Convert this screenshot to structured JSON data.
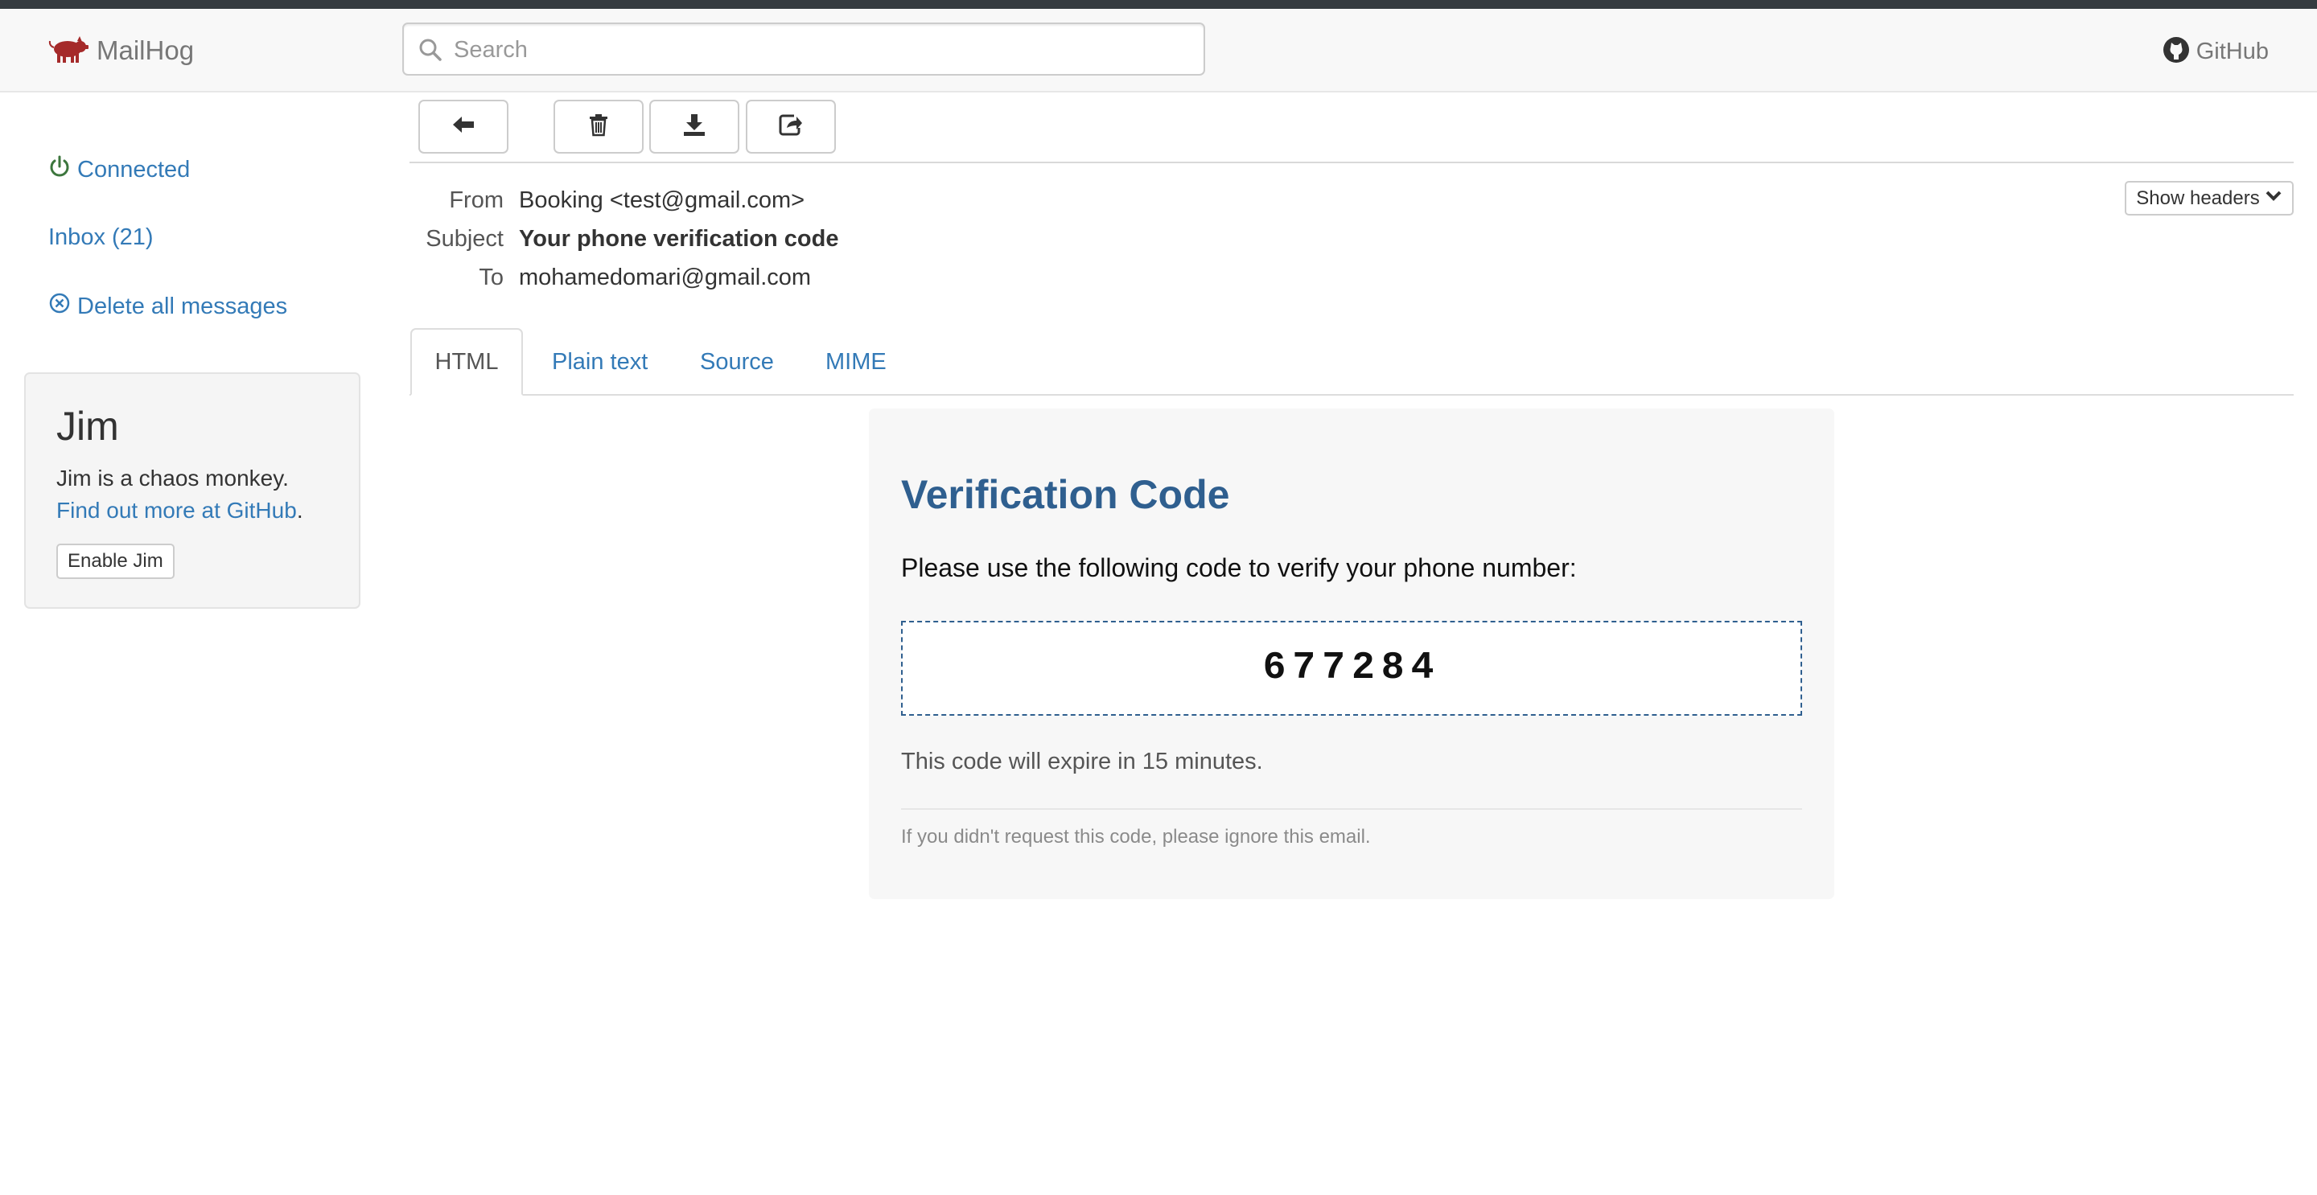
{
  "navbar": {
    "brand": "MailHog",
    "search_placeholder": "Search",
    "github_label": "GitHub"
  },
  "sidebar": {
    "connected_label": "Connected",
    "inbox_label": "Inbox (21)",
    "delete_all_label": "Delete all messages"
  },
  "jim": {
    "title": "Jim",
    "description": "Jim is a chaos monkey.",
    "link_text": "Find out more at GitHub",
    "link_suffix": ".",
    "button_label": "Enable Jim"
  },
  "message": {
    "from_label": "From",
    "from_value": "Booking <test@gmail.com>",
    "subject_label": "Subject",
    "subject_value": "Your phone verification code",
    "to_label": "To",
    "to_value": "mohamedomari@gmail.com",
    "show_headers_label": "Show headers"
  },
  "tabs": {
    "html": "HTML",
    "plain": "Plain text",
    "source": "Source",
    "mime": "MIME"
  },
  "email": {
    "title": "Verification Code",
    "intro": "Please use the following code to verify your phone number:",
    "code": "677284",
    "expire": "This code will expire in 15 minutes.",
    "footer": "If you didn't request this code, please ignore this email."
  },
  "icons": {
    "brand": "pig-icon",
    "search": "search-icon",
    "github": "github-icon",
    "connected": "power-icon",
    "delete_all": "circle-x-icon",
    "back": "arrow-left-icon",
    "delete": "trash-icon",
    "download": "download-icon",
    "release": "share-icon",
    "show_headers": "chevron-down-icon"
  },
  "colors": {
    "link": "#337ab7",
    "connected": "#3c763d",
    "brand_icon": "#a52a2a",
    "email_title": "#2f5f8f"
  }
}
